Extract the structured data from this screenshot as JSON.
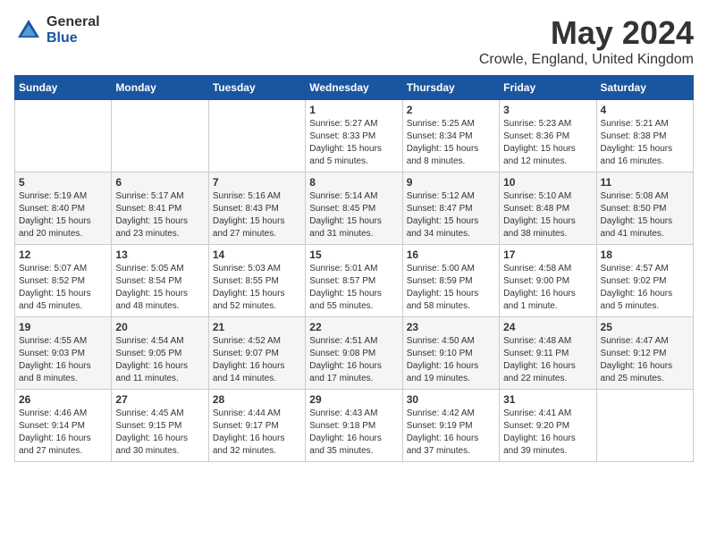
{
  "logo": {
    "general": "General",
    "blue": "Blue"
  },
  "title": "May 2024",
  "location": "Crowle, England, United Kingdom",
  "days_of_week": [
    "Sunday",
    "Monday",
    "Tuesday",
    "Wednesday",
    "Thursday",
    "Friday",
    "Saturday"
  ],
  "weeks": [
    [
      {
        "day": "",
        "info": ""
      },
      {
        "day": "",
        "info": ""
      },
      {
        "day": "",
        "info": ""
      },
      {
        "day": "1",
        "info": "Sunrise: 5:27 AM\nSunset: 8:33 PM\nDaylight: 15 hours\nand 5 minutes."
      },
      {
        "day": "2",
        "info": "Sunrise: 5:25 AM\nSunset: 8:34 PM\nDaylight: 15 hours\nand 8 minutes."
      },
      {
        "day": "3",
        "info": "Sunrise: 5:23 AM\nSunset: 8:36 PM\nDaylight: 15 hours\nand 12 minutes."
      },
      {
        "day": "4",
        "info": "Sunrise: 5:21 AM\nSunset: 8:38 PM\nDaylight: 15 hours\nand 16 minutes."
      }
    ],
    [
      {
        "day": "5",
        "info": "Sunrise: 5:19 AM\nSunset: 8:40 PM\nDaylight: 15 hours\nand 20 minutes."
      },
      {
        "day": "6",
        "info": "Sunrise: 5:17 AM\nSunset: 8:41 PM\nDaylight: 15 hours\nand 23 minutes."
      },
      {
        "day": "7",
        "info": "Sunrise: 5:16 AM\nSunset: 8:43 PM\nDaylight: 15 hours\nand 27 minutes."
      },
      {
        "day": "8",
        "info": "Sunrise: 5:14 AM\nSunset: 8:45 PM\nDaylight: 15 hours\nand 31 minutes."
      },
      {
        "day": "9",
        "info": "Sunrise: 5:12 AM\nSunset: 8:47 PM\nDaylight: 15 hours\nand 34 minutes."
      },
      {
        "day": "10",
        "info": "Sunrise: 5:10 AM\nSunset: 8:48 PM\nDaylight: 15 hours\nand 38 minutes."
      },
      {
        "day": "11",
        "info": "Sunrise: 5:08 AM\nSunset: 8:50 PM\nDaylight: 15 hours\nand 41 minutes."
      }
    ],
    [
      {
        "day": "12",
        "info": "Sunrise: 5:07 AM\nSunset: 8:52 PM\nDaylight: 15 hours\nand 45 minutes."
      },
      {
        "day": "13",
        "info": "Sunrise: 5:05 AM\nSunset: 8:54 PM\nDaylight: 15 hours\nand 48 minutes."
      },
      {
        "day": "14",
        "info": "Sunrise: 5:03 AM\nSunset: 8:55 PM\nDaylight: 15 hours\nand 52 minutes."
      },
      {
        "day": "15",
        "info": "Sunrise: 5:01 AM\nSunset: 8:57 PM\nDaylight: 15 hours\nand 55 minutes."
      },
      {
        "day": "16",
        "info": "Sunrise: 5:00 AM\nSunset: 8:59 PM\nDaylight: 15 hours\nand 58 minutes."
      },
      {
        "day": "17",
        "info": "Sunrise: 4:58 AM\nSunset: 9:00 PM\nDaylight: 16 hours\nand 1 minute."
      },
      {
        "day": "18",
        "info": "Sunrise: 4:57 AM\nSunset: 9:02 PM\nDaylight: 16 hours\nand 5 minutes."
      }
    ],
    [
      {
        "day": "19",
        "info": "Sunrise: 4:55 AM\nSunset: 9:03 PM\nDaylight: 16 hours\nand 8 minutes."
      },
      {
        "day": "20",
        "info": "Sunrise: 4:54 AM\nSunset: 9:05 PM\nDaylight: 16 hours\nand 11 minutes."
      },
      {
        "day": "21",
        "info": "Sunrise: 4:52 AM\nSunset: 9:07 PM\nDaylight: 16 hours\nand 14 minutes."
      },
      {
        "day": "22",
        "info": "Sunrise: 4:51 AM\nSunset: 9:08 PM\nDaylight: 16 hours\nand 17 minutes."
      },
      {
        "day": "23",
        "info": "Sunrise: 4:50 AM\nSunset: 9:10 PM\nDaylight: 16 hours\nand 19 minutes."
      },
      {
        "day": "24",
        "info": "Sunrise: 4:48 AM\nSunset: 9:11 PM\nDaylight: 16 hours\nand 22 minutes."
      },
      {
        "day": "25",
        "info": "Sunrise: 4:47 AM\nSunset: 9:12 PM\nDaylight: 16 hours\nand 25 minutes."
      }
    ],
    [
      {
        "day": "26",
        "info": "Sunrise: 4:46 AM\nSunset: 9:14 PM\nDaylight: 16 hours\nand 27 minutes."
      },
      {
        "day": "27",
        "info": "Sunrise: 4:45 AM\nSunset: 9:15 PM\nDaylight: 16 hours\nand 30 minutes."
      },
      {
        "day": "28",
        "info": "Sunrise: 4:44 AM\nSunset: 9:17 PM\nDaylight: 16 hours\nand 32 minutes."
      },
      {
        "day": "29",
        "info": "Sunrise: 4:43 AM\nSunset: 9:18 PM\nDaylight: 16 hours\nand 35 minutes."
      },
      {
        "day": "30",
        "info": "Sunrise: 4:42 AM\nSunset: 9:19 PM\nDaylight: 16 hours\nand 37 minutes."
      },
      {
        "day": "31",
        "info": "Sunrise: 4:41 AM\nSunset: 9:20 PM\nDaylight: 16 hours\nand 39 minutes."
      },
      {
        "day": "",
        "info": ""
      }
    ]
  ]
}
